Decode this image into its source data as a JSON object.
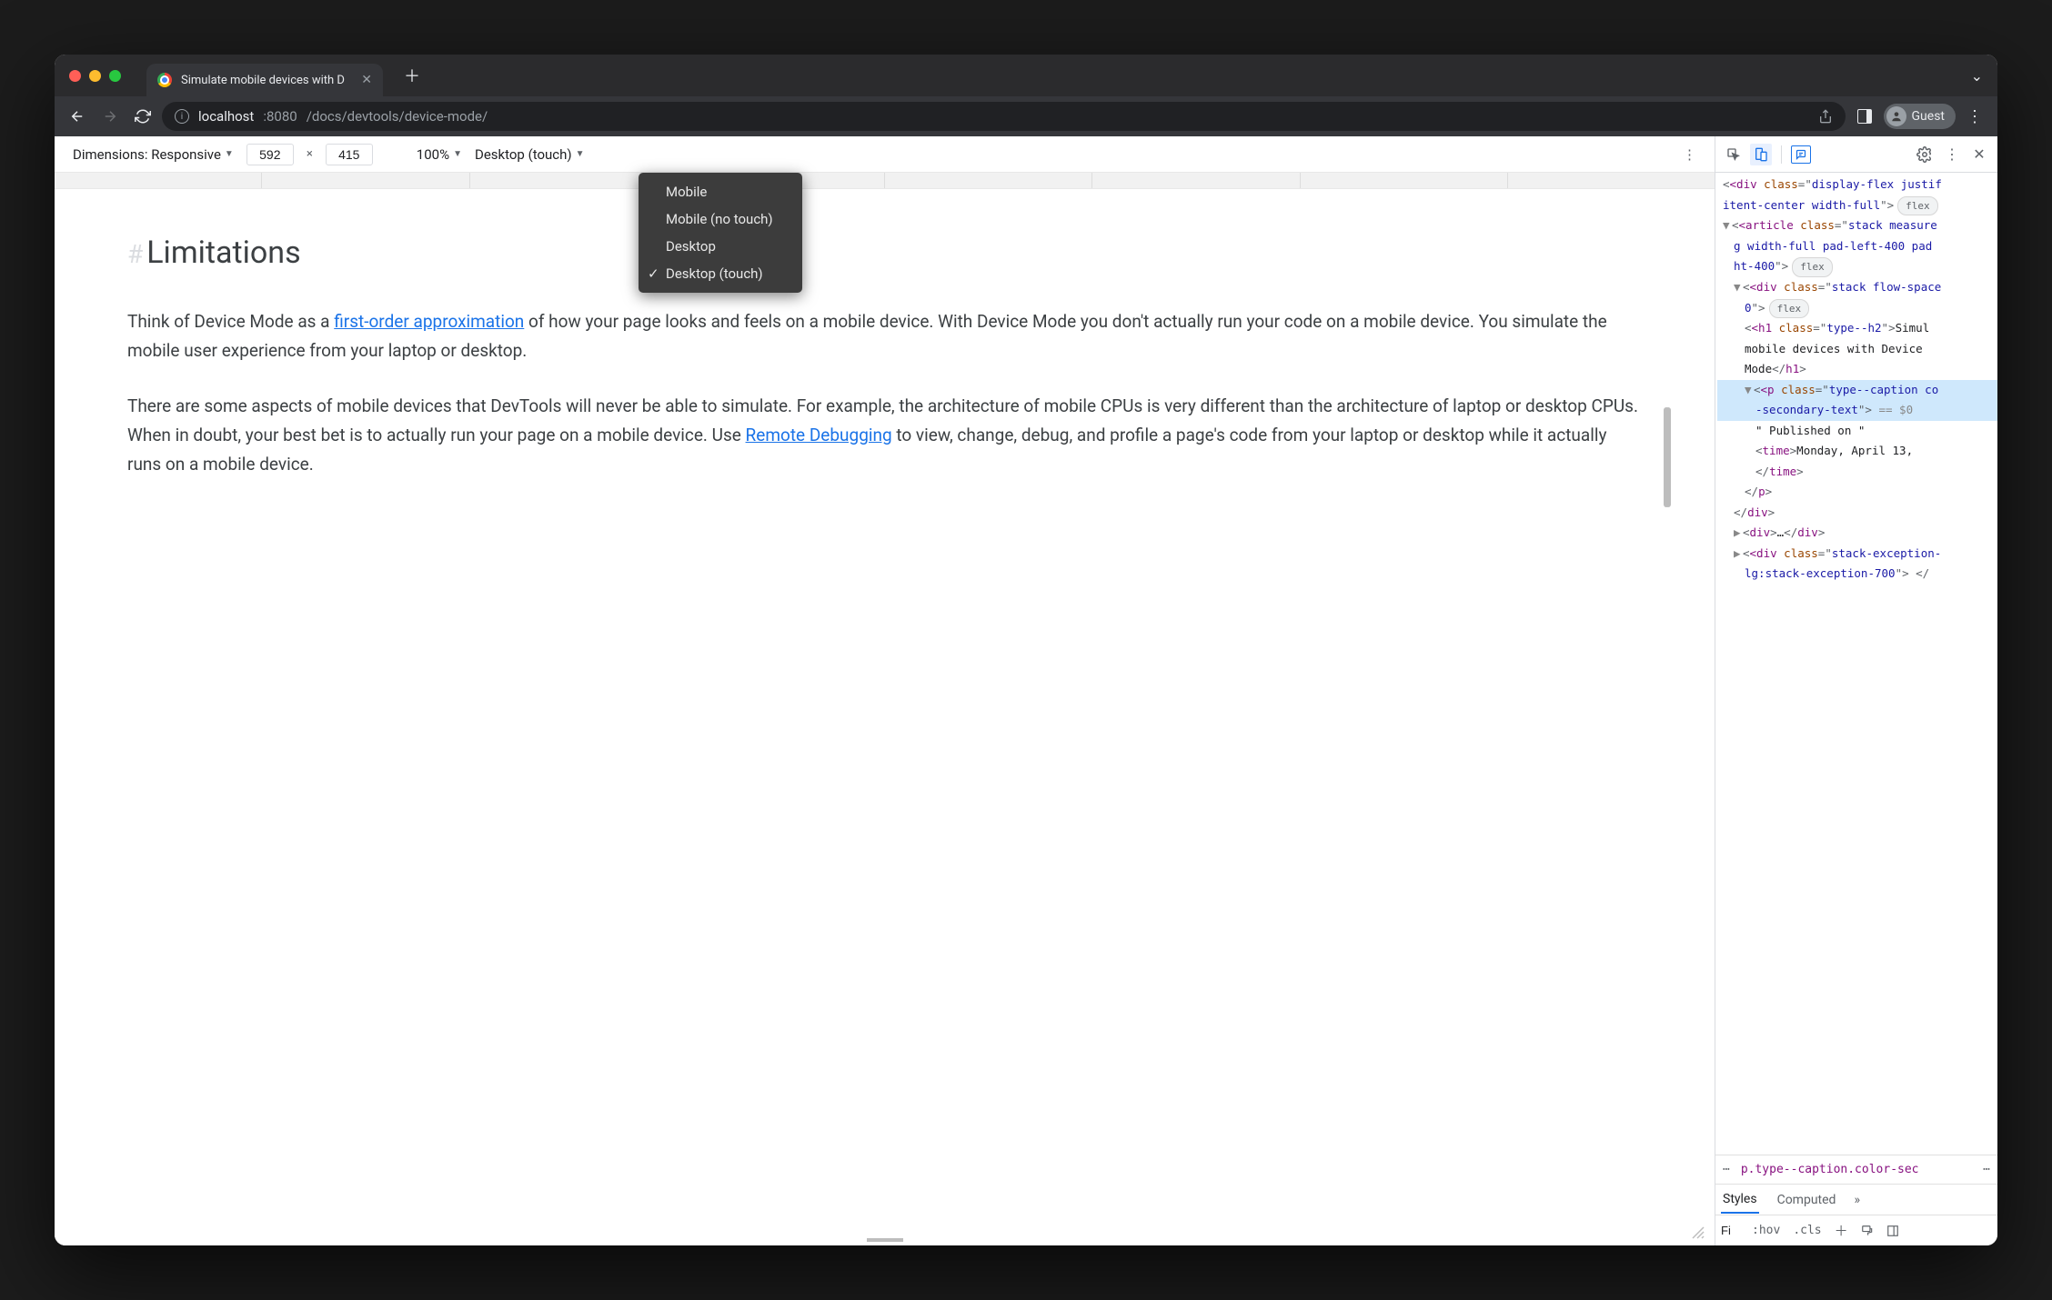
{
  "titlebar": {
    "tab_title": "Simulate mobile devices with D",
    "close_glyph": "✕",
    "newtab_glyph": "＋",
    "menu_glyph": "⌄"
  },
  "urlbar": {
    "host": "localhost",
    "port": ":8080",
    "path": "/docs/devtools/device-mode/",
    "share_glyph": "⇧",
    "guest_label": "Guest",
    "kebab_glyph": "⋮"
  },
  "device_toolbar": {
    "dimensions_label": "Dimensions: Responsive",
    "width": "592",
    "height": "415",
    "zoom": "100%",
    "device_type": "Desktop (touch)",
    "more_glyph": "⋮",
    "dropdown": {
      "opt1": "Mobile",
      "opt2": "Mobile (no touch)",
      "opt3": "Desktop",
      "opt4": "Desktop (touch)"
    }
  },
  "page": {
    "hash": "#",
    "heading": "Limitations",
    "p1a": "Think of Device Mode as a ",
    "p1_link": "first-order approximation",
    "p1b": " of how your page looks and feels on a mobile device. With Device Mode you don't actually run your code on a mobile device. You simulate the mobile user experience from your laptop or desktop.",
    "p2a": "There are some aspects of mobile devices that DevTools will never be able to simulate. For example, the architecture of mobile CPUs is very different than the architecture of laptop or desktop CPUs. When in doubt, your best bet is to actually run your page on a mobile device. Use ",
    "p2_link": "Remote Debugging",
    "p2b": " to view, change, debug, and profile a page's code from your laptop or desktop while it actually runs on a mobile device."
  },
  "devtools": {
    "elements": {
      "l1a": "<div",
      "l1b": " class",
      "l1c": "=\"",
      "l1d": "display-flex justif",
      "l1e": "\"",
      "l2": "itent-center width-full",
      "l2b": "flex",
      "l3a": "<article",
      "l3b": " class",
      "l3c": "=\"",
      "l3d": "stack measure",
      "l4": "g width-full pad-left-400 pad",
      "l5": "ht-400",
      "l5b": "flex",
      "l6a": "<div",
      "l6b": " class",
      "l6c": "=\"",
      "l6d": "stack flow-space",
      "l7": "0",
      "l7b": "flex",
      "l8a": "<h1",
      "l8b": " class",
      "l8c": "=\"",
      "l8d": "type--h2",
      "l8e": ">",
      "l8f": "Simul",
      "l9": "mobile devices with Device",
      "l10": "Mode",
      "l10b": "</h1>",
      "l11a": "<p",
      "l11b": " class",
      "l11c": "=\"",
      "l11d": "type--caption co",
      "l12": "-secondary-text",
      "l12b": " == $0",
      "l13": "\" Published on \"",
      "l14a": "<time>",
      "l14b": "Monday, April 13,",
      "l15": "</time>",
      "l16": "</p>",
      "l17": "</div>",
      "l18a": "<div>",
      "l18b": "…",
      "l18c": "</div>",
      "l19a": "<div",
      "l19b": " class",
      "l19c": "=\"",
      "l19d": "stack-exception-",
      "l20": "lg:stack-exception-700"
    },
    "crumb_dots": "⋯",
    "crumb_seg": "p.type--caption.color-sec",
    "crumb_more": "⋯",
    "tab_styles": "Styles",
    "tab_computed": "Computed",
    "tab_more": "»",
    "filter": "Fi",
    "hov": ":hov",
    "cls": ".cls"
  }
}
